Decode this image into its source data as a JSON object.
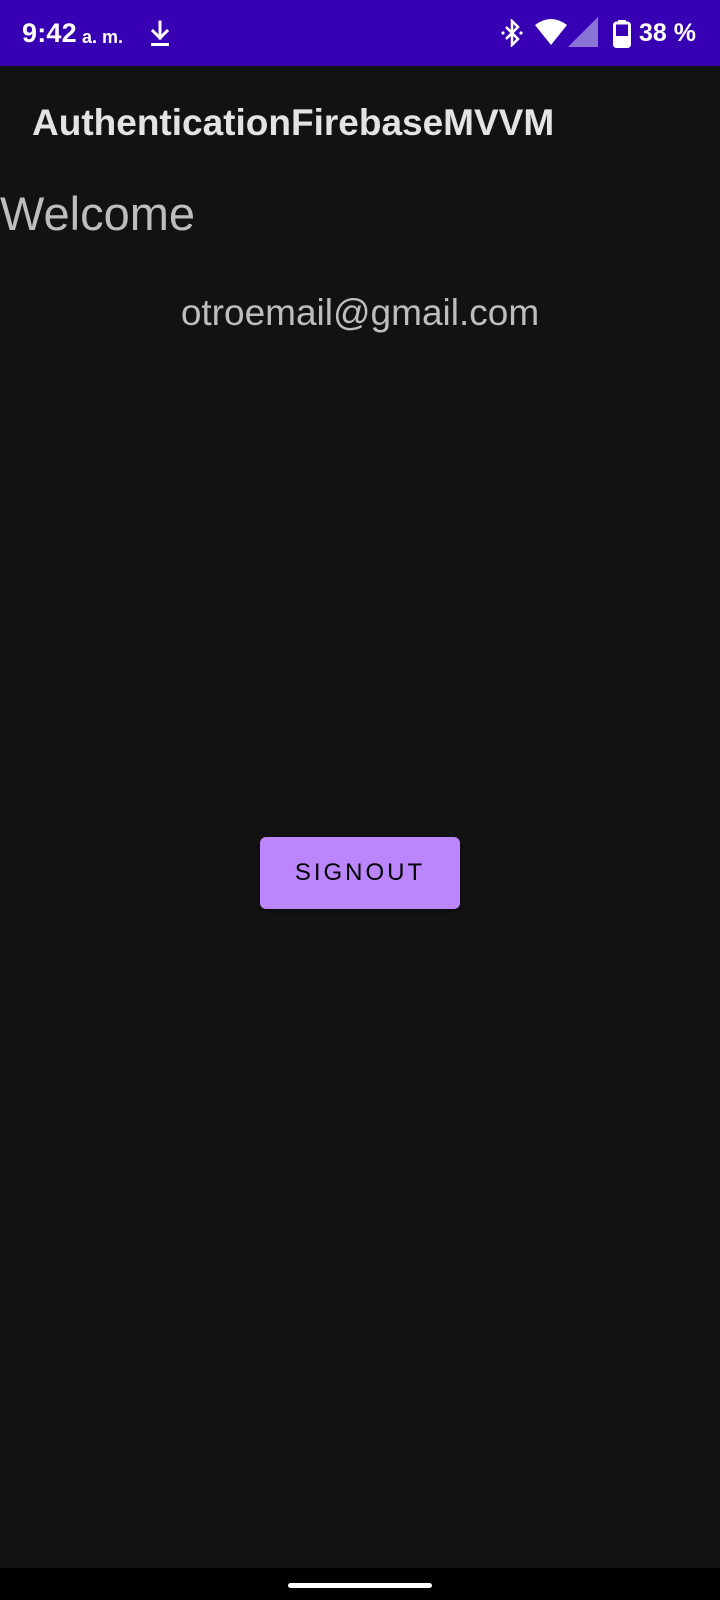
{
  "status_bar": {
    "time": "9:42",
    "ampm": "a. m.",
    "battery_text": "38 %",
    "background_color": "#3700B3",
    "icons": [
      "download-icon",
      "bluetooth-icon",
      "wifi-icon",
      "cell-signal-icon",
      "battery-icon"
    ]
  },
  "app_bar": {
    "title": "AuthenticationFirebaseMVVM"
  },
  "main": {
    "welcome_text": "Welcome",
    "email": "otroemail@gmail.com",
    "signout_label": "SIGNOUT",
    "accent_color": "#BB86FC",
    "background_color": "#121212"
  },
  "nav_bar": {
    "icons": [
      "gesture-handle-icon"
    ]
  }
}
